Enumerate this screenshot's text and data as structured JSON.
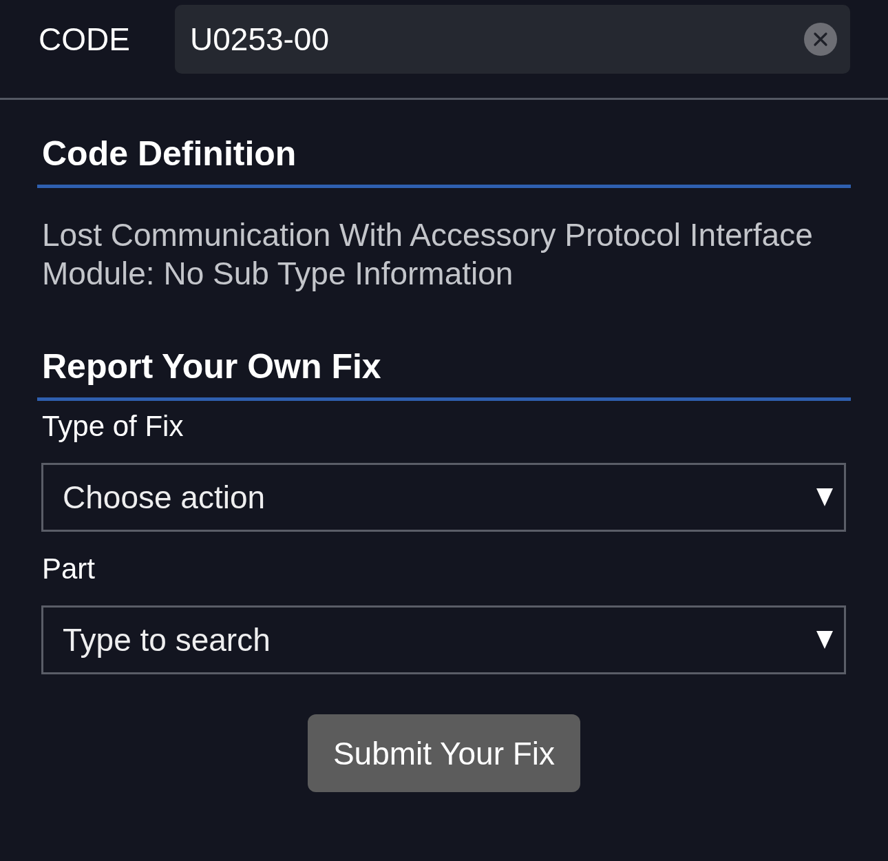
{
  "header": {
    "label": "CODE",
    "code_field": {
      "value": "U0253-00"
    }
  },
  "sections": [
    {
      "kind": "definition",
      "title": "Code Definition",
      "text": "Lost Communication With Accessory Protocol Interface Module: No Sub Type Information"
    },
    {
      "kind": "form",
      "title": "Report Your Own Fix",
      "fields": [
        {
          "label": "Type of Fix",
          "placeholder": "Choose action"
        },
        {
          "label": "Part",
          "placeholder": "Type to search"
        }
      ],
      "submit_button": "Submit Your Fix"
    }
  ]
}
